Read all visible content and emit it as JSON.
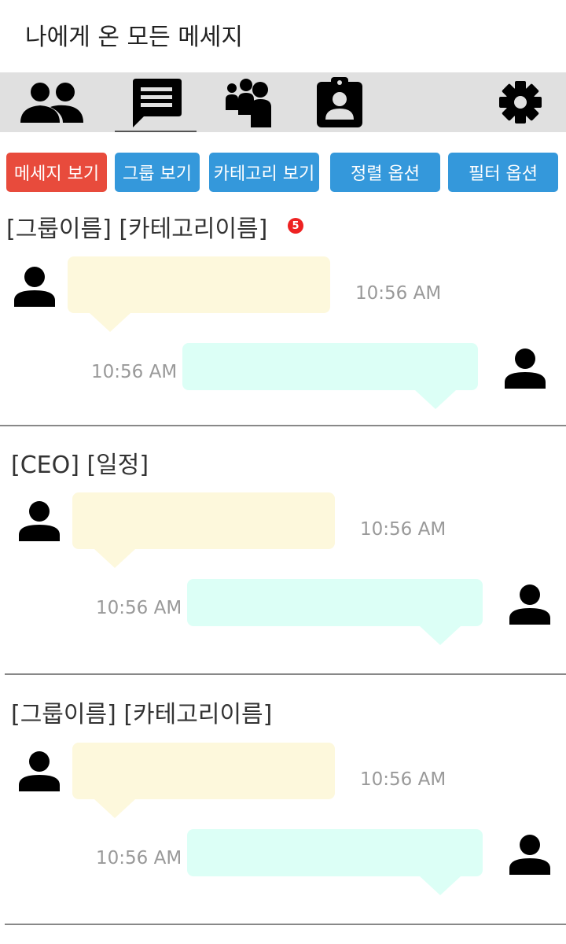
{
  "header": {
    "title": "나에게 온 모든 메세지"
  },
  "nav": {
    "tabs": [
      {
        "icon": "people-icon"
      },
      {
        "icon": "message-icon",
        "active": true
      },
      {
        "icon": "group-icon"
      },
      {
        "icon": "contact-badge-icon"
      },
      {
        "icon": "gear-icon"
      }
    ]
  },
  "filters": {
    "messages": "메세지 보기",
    "groups": "그룹 보기",
    "categories": "카테고리 보기",
    "sort": "정렬 옵션",
    "filter": "필터 옵션"
  },
  "colors": {
    "active_button": "#e84b3c",
    "button": "#3498db",
    "incoming_bubble": "#fdf8dc",
    "outgoing_bubble": "#dcfff6",
    "badge": "#ee2222"
  },
  "threads": [
    {
      "title": "[그룹이름] [카테고리이름]",
      "badge": "5",
      "incoming_time": "10:56 AM",
      "outgoing_time": "10:56 AM"
    },
    {
      "title": "[CEO] [일정]",
      "incoming_time": "10:56 AM",
      "outgoing_time": "10:56 AM"
    },
    {
      "title": "[그룹이름] [카테고리이름]",
      "incoming_time": "10:56 AM",
      "outgoing_time": "10:56 AM"
    }
  ]
}
